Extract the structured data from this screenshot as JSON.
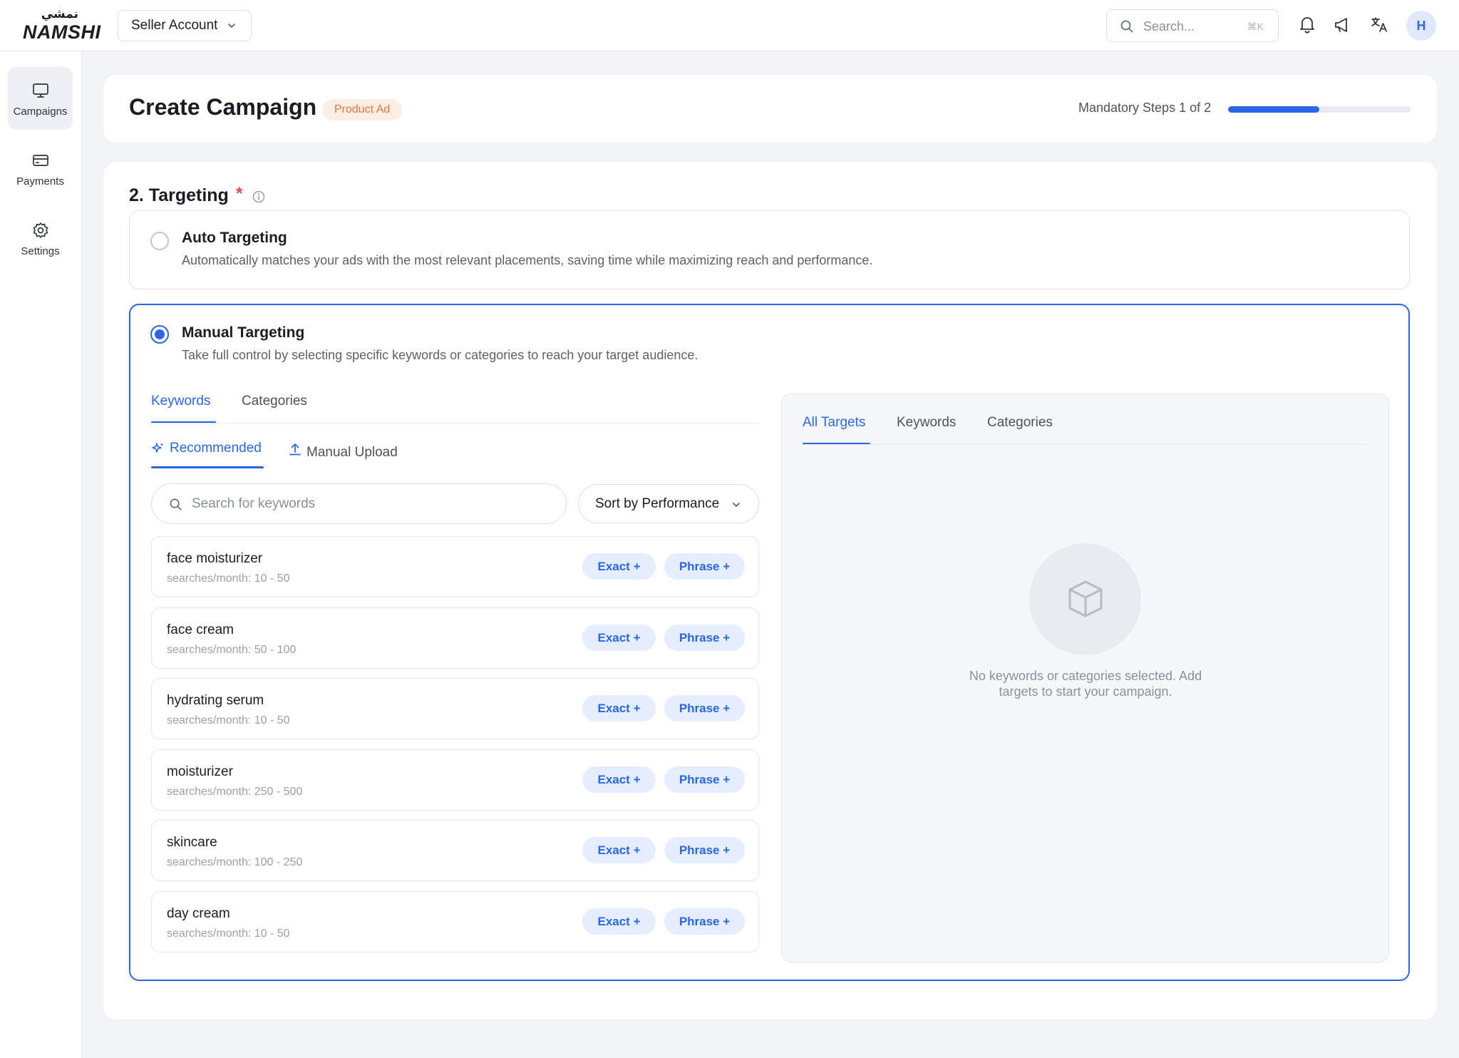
{
  "header": {
    "logo_arabic": "نمشي",
    "logo_text": "NAMSHI",
    "account_label": "Seller Account",
    "search_placeholder": "Search...",
    "search_shortcut": "⌘K",
    "avatar_initial": "H"
  },
  "sidebar": {
    "items": [
      {
        "label": "Campaigns",
        "icon": "monitor-icon",
        "active": true
      },
      {
        "label": "Payments",
        "icon": "credit-card-icon",
        "active": false
      },
      {
        "label": "Settings",
        "icon": "gear-icon",
        "active": false
      }
    ]
  },
  "page": {
    "title": "Create Campaign",
    "badge": "Product Ad",
    "steps_label": "Mandatory Steps 1 of 2",
    "progress_fraction": 0.5
  },
  "targeting": {
    "section_title": "2. Targeting",
    "required_mark": "*",
    "auto": {
      "title": "Auto Targeting",
      "description": "Automatically matches your ads with the most relevant placements, saving time while maximizing reach and performance.",
      "selected": false
    },
    "manual": {
      "title": "Manual Targeting",
      "description": "Take full control by selecting specific keywords or categories to reach your target audience.",
      "selected": true
    },
    "left_tabs": [
      "Keywords",
      "Categories"
    ],
    "sub_tabs": [
      "Recommended",
      "Manual Upload"
    ],
    "keyword_search_placeholder": "Search for keywords",
    "sort_label": "Sort by Performance",
    "exact_label": "Exact +",
    "phrase_label": "Phrase +",
    "keywords": [
      {
        "name": "face moisturizer",
        "meta": "searches/month: 10 - 50"
      },
      {
        "name": "face cream",
        "meta": "searches/month: 50 - 100"
      },
      {
        "name": "hydrating serum",
        "meta": "searches/month: 10 - 50"
      },
      {
        "name": "moisturizer",
        "meta": "searches/month: 250 - 500"
      },
      {
        "name": "skincare",
        "meta": "searches/month: 100 - 250"
      },
      {
        "name": "day cream",
        "meta": "searches/month: 10 - 50"
      }
    ],
    "right_tabs": [
      "All Targets",
      "Keywords",
      "Categories"
    ],
    "empty_line1": "No keywords or categories selected. Add",
    "empty_line2": "targets to start your campaign."
  },
  "colors": {
    "accent": "#2b66e8",
    "badge_bg": "#fdeee4",
    "badge_text": "#e2763a",
    "required": "#e5484d"
  }
}
